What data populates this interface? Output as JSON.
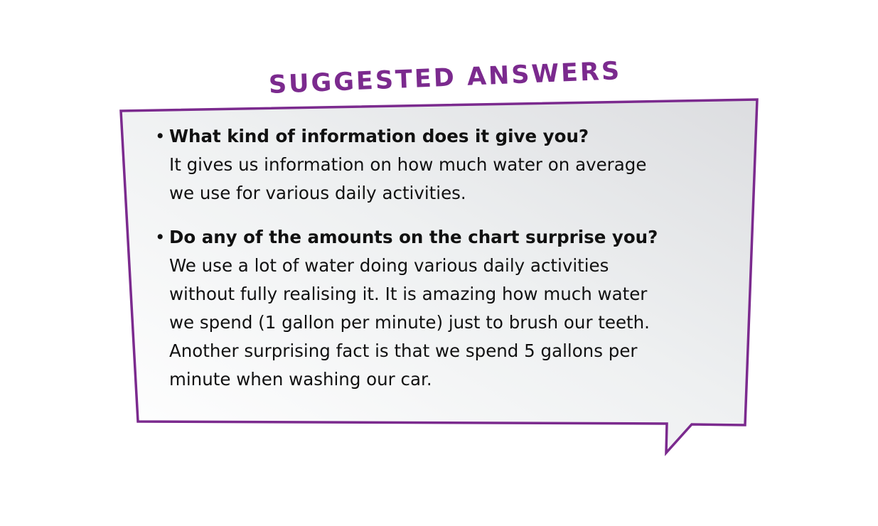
{
  "heading": "SUGGESTED ANSWERS",
  "colors": {
    "accent": "#7b2a8e",
    "bubble_fill_light": "#ffffff",
    "bubble_fill_dark": "#e0e1e3",
    "text": "#111111"
  },
  "items": [
    {
      "bullet": "•",
      "question": "What kind of information does it give you?",
      "answer_lines": [
        "It gives us information on how much water on average",
        "we use for various daily activities."
      ]
    },
    {
      "bullet": "•",
      "question": "Do any of the amounts on the chart surprise you?",
      "answer_lines": [
        "We use a lot of water doing various daily activities",
        "without fully realising it. It is amazing how much water",
        "we spend (1 gallon per minute) just to brush our teeth.",
        "Another surprising fact is that we spend 5 gallons per",
        "minute when washing our car."
      ]
    }
  ]
}
